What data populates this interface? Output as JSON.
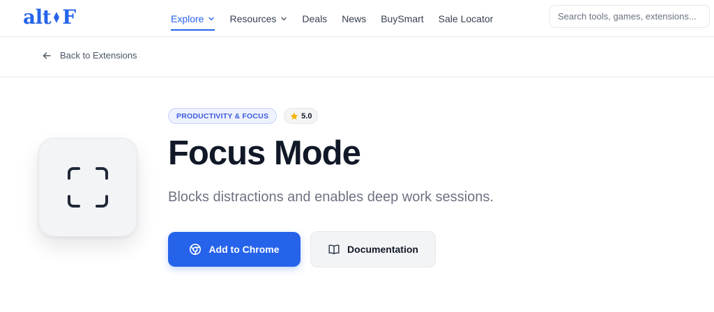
{
  "brand": {
    "logo_left": "alt",
    "logo_right": "F",
    "accent": "#2563eb"
  },
  "nav": {
    "items": [
      {
        "label": "Explore",
        "dropdown": true,
        "active": true
      },
      {
        "label": "Resources",
        "dropdown": true,
        "active": false
      },
      {
        "label": "Deals",
        "dropdown": false,
        "active": false
      },
      {
        "label": "News",
        "dropdown": false,
        "active": false
      },
      {
        "label": "BuySmart",
        "dropdown": false,
        "active": false
      },
      {
        "label": "Sale Locator",
        "dropdown": false,
        "active": false
      }
    ]
  },
  "search": {
    "placeholder": "Search tools, games, extensions...",
    "icon": "none"
  },
  "breadcrumb": {
    "back_label": "Back to Extensions",
    "icon": "arrow-left-icon"
  },
  "extension": {
    "icon": "focus-frame-icon",
    "category": "PRODUCTIVITY & FOCUS",
    "rating": "5.0",
    "rating_icon": "star-icon",
    "name": "Focus Mode",
    "description": "Blocks distractions and enables deep work sessions."
  },
  "actions": {
    "primary_label": "Add to Chrome",
    "primary_icon": "chrome-icon",
    "secondary_label": "Documentation",
    "secondary_icon": "book-icon"
  },
  "colors": {
    "primary": "#2563eb",
    "star": "#f5b301",
    "badge_text": "#3b5bdb"
  }
}
